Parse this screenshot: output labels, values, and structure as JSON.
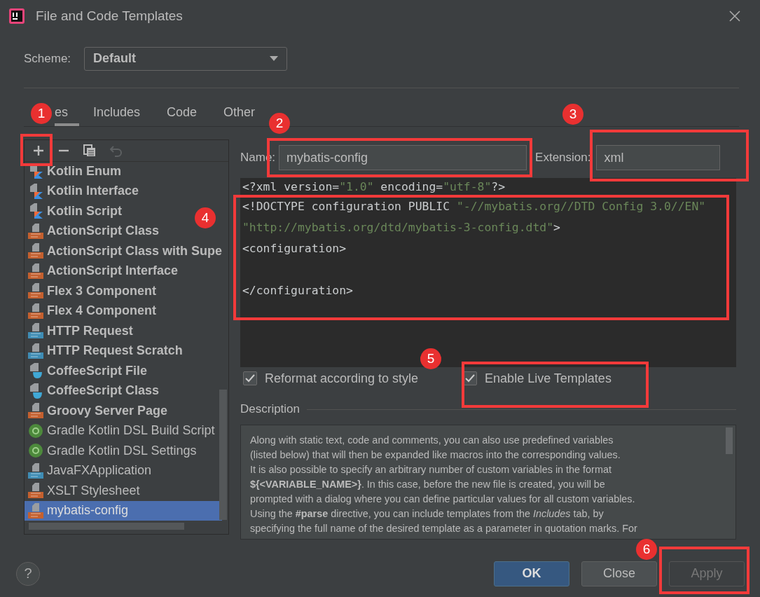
{
  "window": {
    "title": "File and Code Templates"
  },
  "scheme": {
    "label": "Scheme:",
    "value": "Default"
  },
  "tabs": [
    {
      "label": "es",
      "selected": true
    },
    {
      "label": "Includes",
      "selected": false
    },
    {
      "label": "Code",
      "selected": false
    },
    {
      "label": "Other",
      "selected": false
    }
  ],
  "templates": [
    {
      "label": "Kotlin Enum",
      "kind": "kotlin",
      "bold": true,
      "selected": false
    },
    {
      "label": "Kotlin Interface",
      "kind": "kotlin",
      "bold": true,
      "selected": false
    },
    {
      "label": "Kotlin Script",
      "kind": "kotlin",
      "bold": true,
      "selected": false
    },
    {
      "label": "ActionScript Class",
      "kind": "as",
      "bold": true,
      "selected": false
    },
    {
      "label": "ActionScript Class with Supe",
      "kind": "as",
      "bold": true,
      "selected": false
    },
    {
      "label": "ActionScript Interface",
      "kind": "as",
      "bold": true,
      "selected": false
    },
    {
      "label": "Flex 3 Component",
      "kind": "xml",
      "bold": true,
      "selected": false
    },
    {
      "label": "Flex 4 Component",
      "kind": "xml",
      "bold": true,
      "selected": false
    },
    {
      "label": "HTTP Request",
      "kind": "api",
      "bold": true,
      "selected": false
    },
    {
      "label": "HTTP Request Scratch",
      "kind": "api",
      "bold": true,
      "selected": false
    },
    {
      "label": "CoffeeScript File",
      "kind": "coffee",
      "bold": true,
      "selected": false
    },
    {
      "label": "CoffeeScript Class",
      "kind": "coffee",
      "bold": true,
      "selected": false
    },
    {
      "label": "Groovy Server Page",
      "kind": "gsp",
      "bold": true,
      "selected": false
    },
    {
      "label": "Gradle Kotlin DSL Build Script",
      "kind": "gradle",
      "bold": false,
      "selected": false
    },
    {
      "label": "Gradle Kotlin DSL Settings",
      "kind": "gradle",
      "bold": false,
      "selected": false
    },
    {
      "label": "JavaFXApplication",
      "kind": "java",
      "bold": false,
      "selected": false
    },
    {
      "label": "XSLT Stylesheet",
      "kind": "xml",
      "bold": false,
      "selected": false
    },
    {
      "label": "mybatis-config",
      "kind": "xml",
      "bold": false,
      "selected": true
    }
  ],
  "name_field": {
    "label": "Name:",
    "value": "mybatis-config"
  },
  "extension_field": {
    "label": "Extension:",
    "value": "xml"
  },
  "code_lines": [
    {
      "kind": "code",
      "segments": [
        {
          "kind": "tag",
          "text": "<?xml version="
        },
        {
          "kind": "string",
          "text": "\"1.0\""
        },
        {
          "kind": "tag",
          "text": " encoding="
        },
        {
          "kind": "string",
          "text": "\"utf-8\""
        },
        {
          "kind": "tag",
          "text": "?>"
        }
      ]
    },
    {
      "kind": "code",
      "segments": [
        {
          "kind": "tag",
          "text": "<!DOCTYPE configuration PUBLIC "
        },
        {
          "kind": "string",
          "text": "\"-//mybatis.org//DTD Config 3.0//EN\""
        }
      ]
    },
    {
      "kind": "code",
      "segments": [
        {
          "kind": "string",
          "text": "\"http://mybatis.org/dtd/mybatis-3-config.dtd\""
        },
        {
          "kind": "tag",
          "text": ">"
        }
      ]
    },
    {
      "kind": "code",
      "segments": [
        {
          "kind": "tag",
          "text": "<configuration>"
        }
      ]
    },
    {
      "kind": "blank"
    },
    {
      "kind": "code",
      "segments": [
        {
          "kind": "tag",
          "text": "</configuration>"
        }
      ]
    }
  ],
  "options": [
    {
      "label": "Reformat according to style",
      "checked": true
    },
    {
      "label": "Enable Live Templates",
      "checked": true
    }
  ],
  "description": {
    "title": "Description",
    "lines": [
      "Along with static text, code and comments, you can also use predefined variables",
      "(listed below) that will then be expanded like macros into the corresponding values.",
      "It is also possible to specify an arbitrary number of custom variables in the format",
      "**${<VARIABLE_NAME>}**. In this case, before the new file is created, you will be",
      "prompted with a dialog where you can define particular values for all custom variables.",
      "Using the **#parse** directive, you can include templates from the *Includes* tab, by",
      "specifying the full name of the desired template as a parameter in quotation marks. For"
    ]
  },
  "help": {
    "label": "?"
  },
  "buttons": [
    {
      "label": "OK",
      "kind": "primary",
      "disabled": false
    },
    {
      "label": "Close",
      "kind": "normal",
      "disabled": false
    },
    {
      "label": "Apply",
      "kind": "normal",
      "disabled": true
    }
  ],
  "annotations": [
    {
      "label": "1"
    },
    {
      "label": "2"
    },
    {
      "label": "3"
    },
    {
      "label": "4"
    },
    {
      "label": "5"
    },
    {
      "label": "6"
    }
  ]
}
